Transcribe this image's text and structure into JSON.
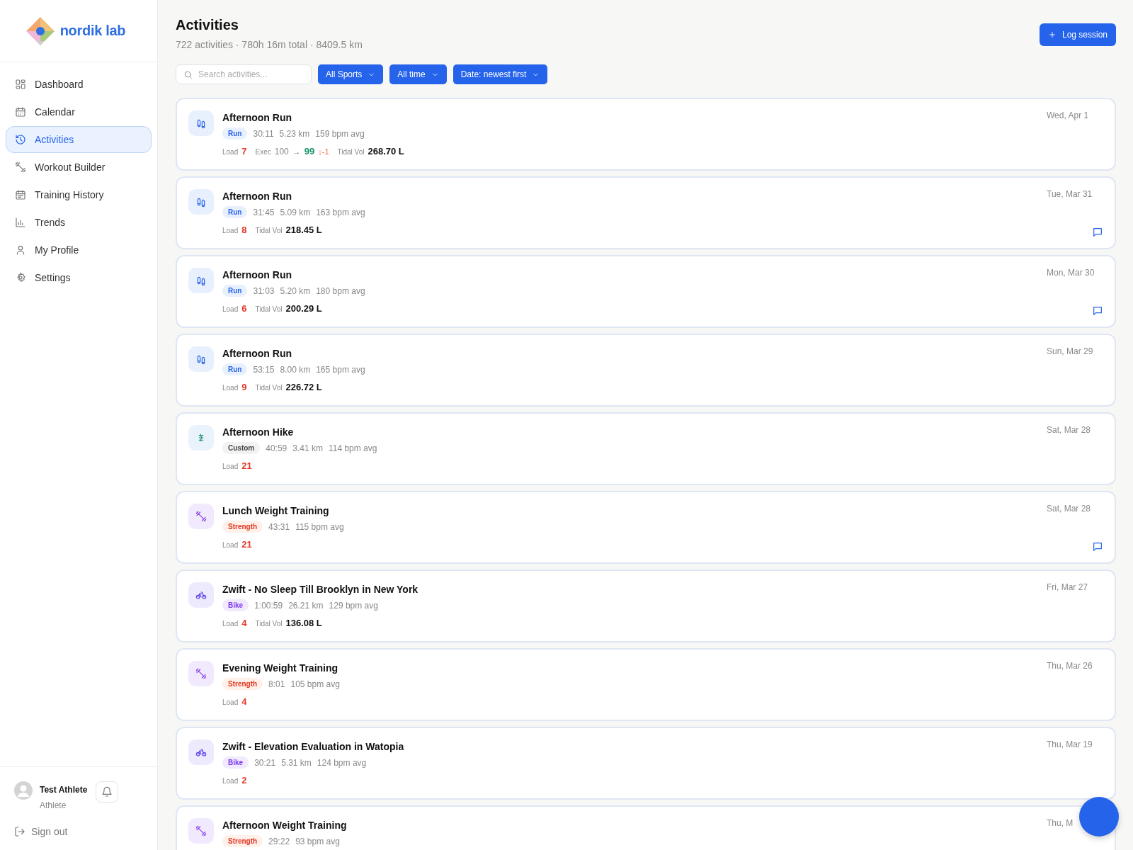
{
  "brand": {
    "name": "nordik lab"
  },
  "nav": [
    {
      "label": "Dashboard",
      "selected": false
    },
    {
      "label": "Calendar",
      "selected": false
    },
    {
      "label": "Activities",
      "selected": true
    },
    {
      "label": "Workout Builder",
      "selected": false
    },
    {
      "label": "Training History",
      "selected": false
    },
    {
      "label": "Trends",
      "selected": false
    },
    {
      "label": "My Profile",
      "selected": false
    },
    {
      "label": "Settings",
      "selected": false
    }
  ],
  "user": {
    "name": "Test Athlete",
    "role": "Athlete",
    "sign_out": "Sign out"
  },
  "header": {
    "title": "Activities",
    "summary": "722 activities · 780h 16m total · 8409.5 km",
    "action": "Log session"
  },
  "filters": {
    "placeholder": "Search activities...",
    "dropdowns": [
      "All Sports",
      "All time",
      "Date: newest first"
    ]
  },
  "activities": [
    {
      "title": "Afternoon Run",
      "kind": "run",
      "sport": "Run",
      "stats": [
        "30:11",
        "5.23 km",
        "159 bpm avg"
      ],
      "load": {
        "label": "Load",
        "value": "7"
      },
      "exec": {
        "label": "Exec",
        "from": "100",
        "arrow": "→",
        "to": "99",
        "delta": "↓-1"
      },
      "tidal": {
        "label": "Tidal Vol",
        "value": "268.70 L"
      },
      "date": "Wed, Apr 1",
      "comment": false
    },
    {
      "title": "Afternoon Run",
      "kind": "run",
      "sport": "Run",
      "stats": [
        "31:45",
        "5.09 km",
        "163 bpm avg"
      ],
      "load": {
        "label": "Load",
        "value": "8"
      },
      "tidal": {
        "label": "Tidal Vol",
        "value": "218.45 L"
      },
      "date": "Tue, Mar 31",
      "comment": true
    },
    {
      "title": "Afternoon Run",
      "kind": "run",
      "sport": "Run",
      "stats": [
        "31:03",
        "5.20 km",
        "180 bpm avg"
      ],
      "load": {
        "label": "Load",
        "value": "6"
      },
      "tidal": {
        "label": "Tidal Vol",
        "value": "200.29 L"
      },
      "date": "Mon, Mar 30",
      "comment": true
    },
    {
      "title": "Afternoon Run",
      "kind": "run",
      "sport": "Run",
      "stats": [
        "53:15",
        "8.00 km",
        "165 bpm avg"
      ],
      "load": {
        "label": "Load",
        "value": "9"
      },
      "tidal": {
        "label": "Tidal Vol",
        "value": "226.72 L"
      },
      "date": "Sun, Mar 29",
      "comment": false
    },
    {
      "title": "Afternoon Hike",
      "kind": "custom",
      "sport": "Custom",
      "stats": [
        "40:59",
        "3.41 km",
        "114 bpm avg"
      ],
      "load": {
        "label": "Load",
        "value": "21"
      },
      "date": "Sat, Mar 28",
      "comment": false
    },
    {
      "title": "Lunch Weight Training",
      "kind": "strength",
      "sport": "Strength",
      "stats": [
        "43:31",
        "115 bpm avg"
      ],
      "load": {
        "label": "Load",
        "value": "21"
      },
      "date": "Sat, Mar 28",
      "comment": true
    },
    {
      "title": "Zwift - No Sleep Till Brooklyn in New York",
      "kind": "bike",
      "sport": "Bike",
      "stats": [
        "1:00:59",
        "26.21 km",
        "129 bpm avg"
      ],
      "load": {
        "label": "Load",
        "value": "4"
      },
      "tidal": {
        "label": "Tidal Vol",
        "value": "136.08 L"
      },
      "date": "Fri, Mar 27",
      "comment": false
    },
    {
      "title": "Evening Weight Training",
      "kind": "strength",
      "sport": "Strength",
      "stats": [
        "8:01",
        "105 bpm avg"
      ],
      "load": {
        "label": "Load",
        "value": "4"
      },
      "date": "Thu, Mar 26",
      "comment": false
    },
    {
      "title": "Zwift - Elevation Evaluation in Watopia",
      "kind": "bike",
      "sport": "Bike",
      "stats": [
        "30:21",
        "5.31 km",
        "124 bpm avg"
      ],
      "load": {
        "label": "Load",
        "value": "2"
      },
      "date": "Thu, Mar 19",
      "comment": false
    },
    {
      "title": "Afternoon Weight Training",
      "kind": "strength",
      "sport": "Strength",
      "stats": [
        "29:22",
        "93 bpm avg"
      ],
      "date": "Thu, M",
      "comment": false
    }
  ]
}
